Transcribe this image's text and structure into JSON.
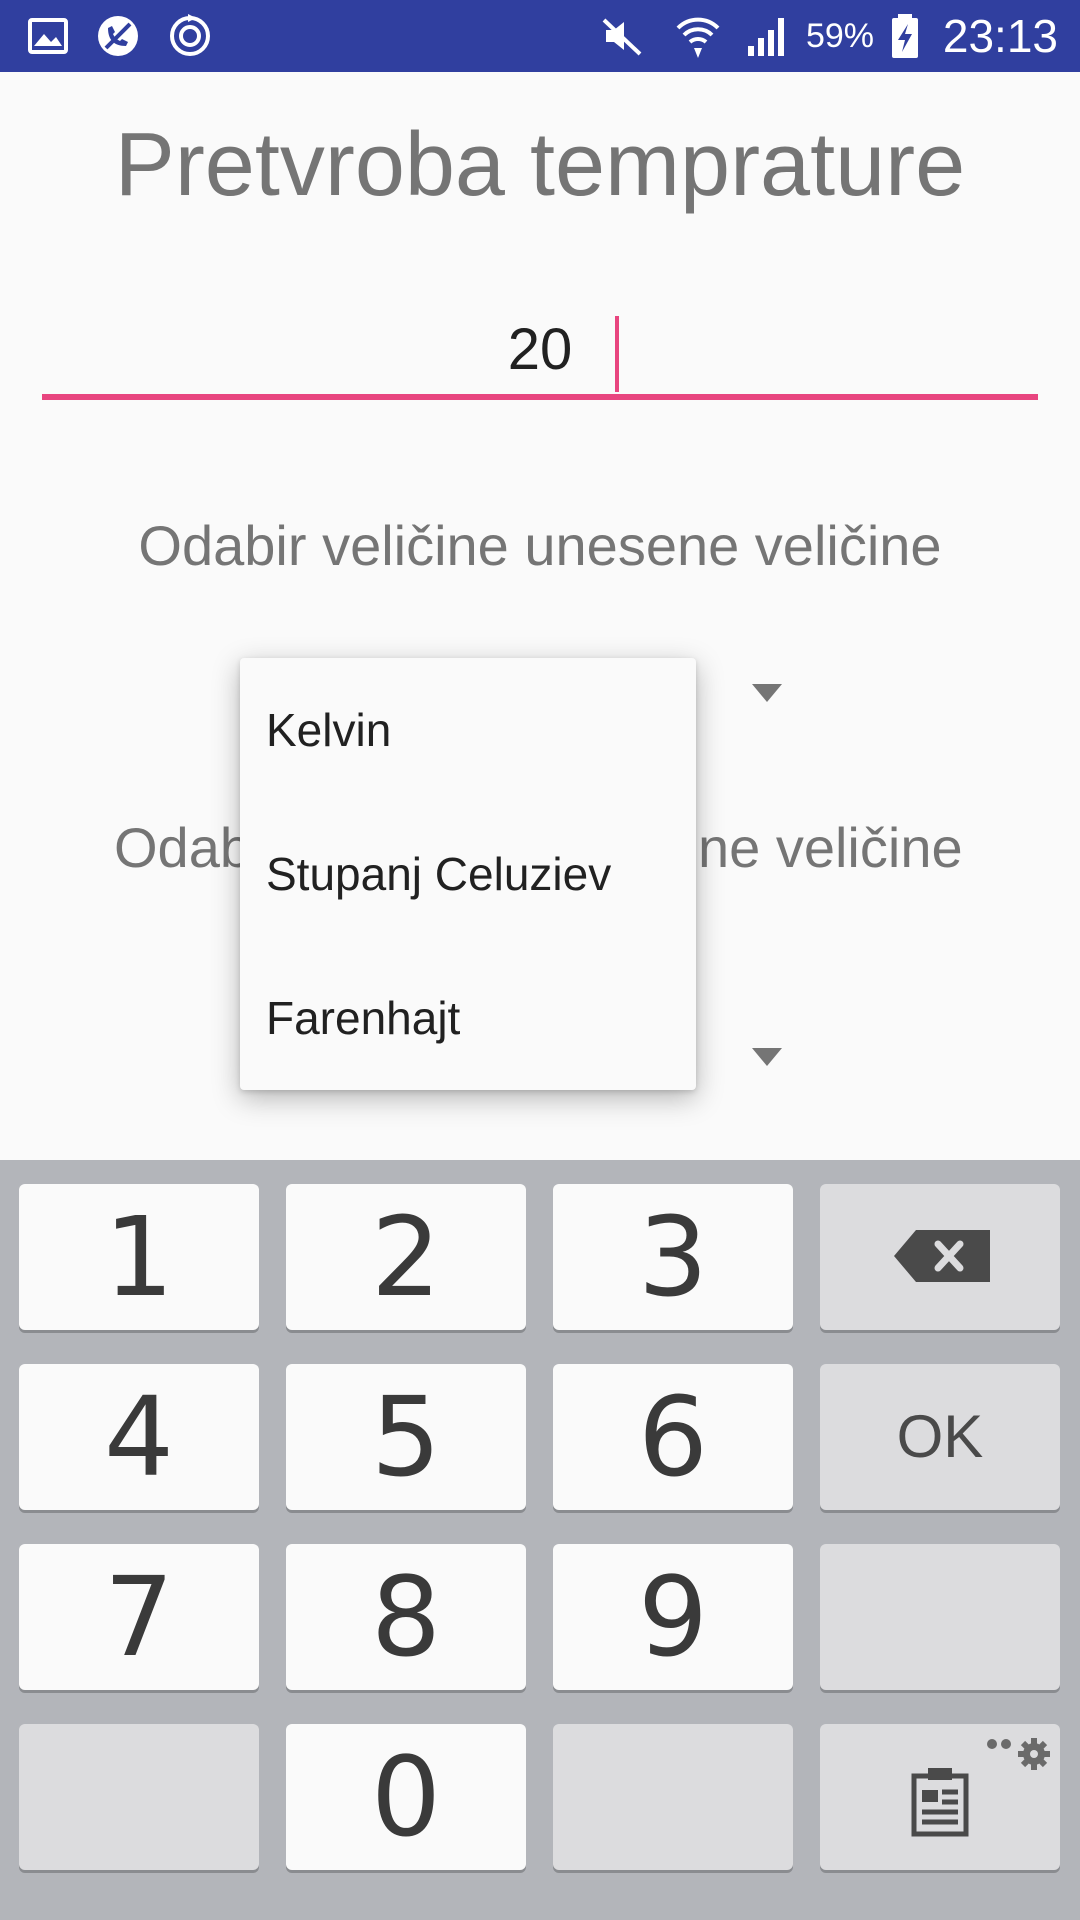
{
  "status_bar": {
    "battery_percent": "59%",
    "time": "23:13",
    "icons": [
      "gallery-icon",
      "blocked-call-icon",
      "sync-icon",
      "mute-icon",
      "wifi-icon",
      "signal-icon",
      "battery-charging-icon"
    ],
    "background_color": "#303f9f"
  },
  "app": {
    "title": "Pretvroba temprature",
    "input_value": "20",
    "label_from": "Odabir veličine unesene veličine",
    "label_to_left": "Odab",
    "label_to_right": "ne veličine",
    "accent_color": "#e8457f"
  },
  "dropdown": {
    "items": [
      "Kelvin",
      "Stupanj Celuziev",
      "Farenhajt"
    ]
  },
  "keyboard": {
    "keys": [
      "1",
      "2",
      "3",
      "4",
      "5",
      "6",
      "7",
      "8",
      "9",
      "0"
    ],
    "ok_label": "OK",
    "icons": [
      "backspace-icon",
      "clipboard-icon",
      "settings-icon"
    ]
  }
}
